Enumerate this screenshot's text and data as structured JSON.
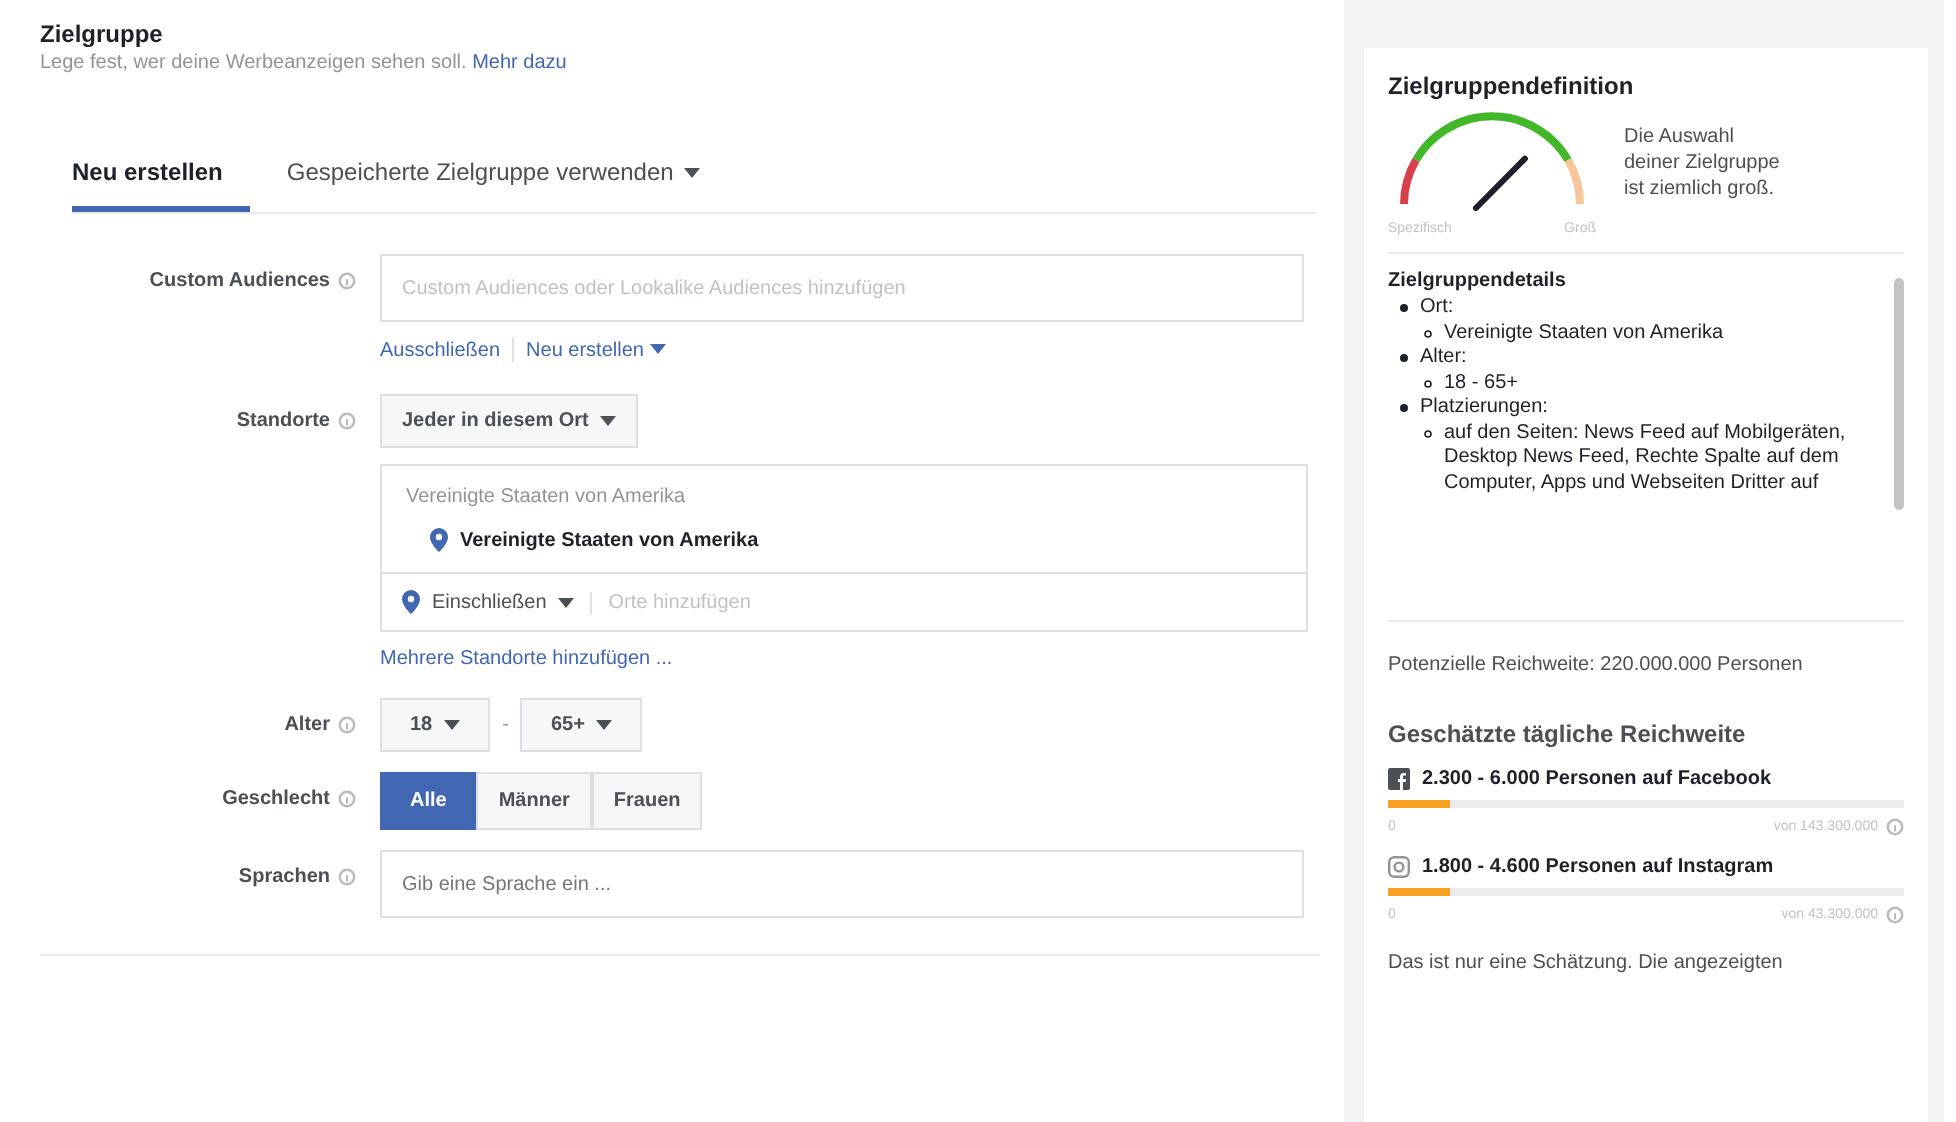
{
  "header": {
    "title": "Zielgruppe",
    "subtitle": "Lege fest, wer deine Werbeanzeigen sehen soll.",
    "link": "Mehr dazu"
  },
  "tabs": [
    {
      "label": "Neu erstellen",
      "selected": true,
      "dropdown": false
    },
    {
      "label": "Gespeicherte Zielgruppe verwenden",
      "selected": false,
      "dropdown": true
    }
  ],
  "custom_audiences": {
    "label": "Custom Audiences",
    "placeholder": "Custom Audiences oder Lookalike Audiences hinzufügen",
    "links": [
      "Ausschließen",
      "Neu erstellen"
    ]
  },
  "locations": {
    "label": "Standorte",
    "mode": "Jeder in diesem Ort",
    "list_heading": "Vereinigte Staaten von Amerika",
    "selected_location": "Vereinigte Staaten von Amerika",
    "include": "Einschließen",
    "placeholder": "Orte hinzufügen",
    "link": "Mehrere Standorte hinzufügen ..."
  },
  "age": {
    "label": "Alter",
    "from": "18",
    "separator": "-",
    "to": "65+"
  },
  "gender": {
    "label": "Geschlecht",
    "options": [
      {
        "label": "Alle",
        "selected": true
      },
      {
        "label": "Männer",
        "selected": false
      },
      {
        "label": "Frauen",
        "selected": false
      }
    ]
  },
  "languages": {
    "label": "Sprachen",
    "placeholder": "Gib eine Sprache ein ..."
  },
  "sidebar": {
    "title": "Zielgruppendefinition",
    "gauge": {
      "min_label": "Spezifisch",
      "max_label": "Groß"
    },
    "gauge_text": "Die Auswahl deiner Zielgruppe ist ziemlich groß.",
    "details_title": "Zielgruppendetails",
    "details": [
      {
        "text": "Ort:",
        "children": [
          {
            "text": "Vereinigte Staaten von Amerika"
          }
        ]
      },
      {
        "text": "Alter:",
        "children": [
          {
            "text": "18 - 65+"
          }
        ]
      },
      {
        "text": "Platzierungen:",
        "children": [
          {
            "text": "auf den Seiten: News Feed auf Mobilgeräten, Desktop News Feed, Rechte Spalte auf dem Computer, Apps und Webseiten Dritter auf"
          }
        ]
      }
    ],
    "potential_reach": "Potenzielle Reichweite: 220.000.000 Personen",
    "daily_title": "Geschätzte tägliche Reichweite",
    "daily": [
      {
        "kind": "facebook",
        "text": "2.300 - 6.000 Personen auf Facebook",
        "level": 0.12,
        "min": "0",
        "max": "von 143.300.000"
      },
      {
        "kind": "instagram",
        "text": "1.800 - 4.600 Personen auf Instagram",
        "level": 0.12,
        "min": "0",
        "max": "von 43.300.000"
      }
    ],
    "note": "Das ist nur eine Schätzung. Die angezeigten"
  }
}
